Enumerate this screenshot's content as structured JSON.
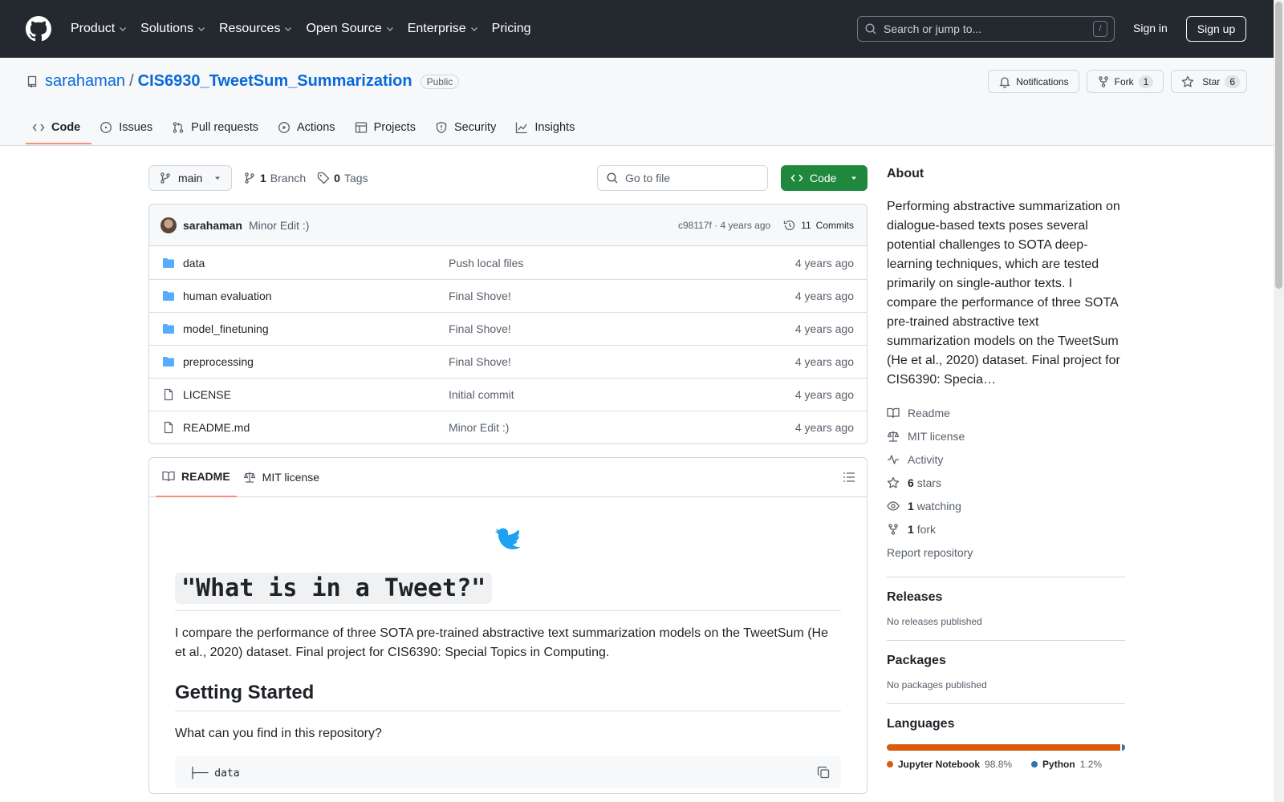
{
  "header": {
    "nav": [
      "Product",
      "Solutions",
      "Resources",
      "Open Source",
      "Enterprise",
      "Pricing"
    ],
    "search_placeholder": "Search or jump to...",
    "search_kbd": "/",
    "sign_in": "Sign in",
    "sign_up": "Sign up"
  },
  "repo": {
    "owner": "sarahaman",
    "name": "CIS6930_TweetSum_Summarization",
    "visibility": "Public",
    "notifications_label": "Notifications",
    "fork_label": "Fork",
    "fork_count": "1",
    "star_label": "Star",
    "star_count": "6",
    "tabs": [
      "Code",
      "Issues",
      "Pull requests",
      "Actions",
      "Projects",
      "Security",
      "Insights"
    ]
  },
  "toolbar": {
    "branch": "main",
    "branch_count": "1",
    "branch_label": "Branch",
    "tag_count": "0",
    "tag_label": "Tags",
    "goto_placeholder": "Go to file",
    "code_button": "Code"
  },
  "commit": {
    "author": "sarahaman",
    "message": "Minor Edit :)",
    "hash_age": "c98117f · 4 years ago",
    "commits_count": "11",
    "commits_label": "Commits"
  },
  "files": [
    {
      "type": "dir",
      "name": "data",
      "commit": "Push local files",
      "age": "4 years ago"
    },
    {
      "type": "dir",
      "name": "human evaluation",
      "commit": "Final Shove!",
      "age": "4 years ago"
    },
    {
      "type": "dir",
      "name": "model_finetuning",
      "commit": "Final Shove!",
      "age": "4 years ago"
    },
    {
      "type": "dir",
      "name": "preprocessing",
      "commit": "Final Shove!",
      "age": "4 years ago"
    },
    {
      "type": "file",
      "name": "LICENSE",
      "commit": "Initial commit",
      "age": "4 years ago"
    },
    {
      "type": "file",
      "name": "README.md",
      "commit": "Minor Edit :)",
      "age": "4 years ago"
    }
  ],
  "readme": {
    "tab_readme": "README",
    "tab_license": "MIT license",
    "h1": "\"What is in a Tweet?\"",
    "intro": "I compare the performance of three SOTA pre-trained abstractive text summarization models on the TweetSum (He et al., 2020) dataset. Final project for CIS6390: Special Topics in Computing.",
    "h2": "Getting Started",
    "p2": "What can you find in this repository?",
    "pre_line": "├── data"
  },
  "about": {
    "title": "About",
    "description": "Performing abstractive summarization on dialogue-based texts poses several potential challenges to SOTA deep-learning techniques, which are tested primarily on single-author texts. I compare the performance of three SOTA pre-trained abstractive text summarization models on the TweetSum (He et al., 2020) dataset. Final project for CIS6390: Specia…",
    "readme": "Readme",
    "license": "MIT license",
    "activity": "Activity",
    "stars_count": "6",
    "stars_label": "stars",
    "watching_count": "1",
    "watching_label": "watching",
    "fork_count": "1",
    "fork_label": "fork",
    "report": "Report repository"
  },
  "releases": {
    "title": "Releases",
    "empty": "No releases published"
  },
  "packages": {
    "title": "Packages",
    "empty": "No packages published"
  },
  "languages": {
    "title": "Languages",
    "items": [
      {
        "name": "Jupyter Notebook",
        "pct": "98.8%",
        "value": 98.8,
        "color": "#DA5B0B"
      },
      {
        "name": "Python",
        "pct": "1.2%",
        "value": 1.2,
        "color": "#3572A5"
      }
    ]
  }
}
